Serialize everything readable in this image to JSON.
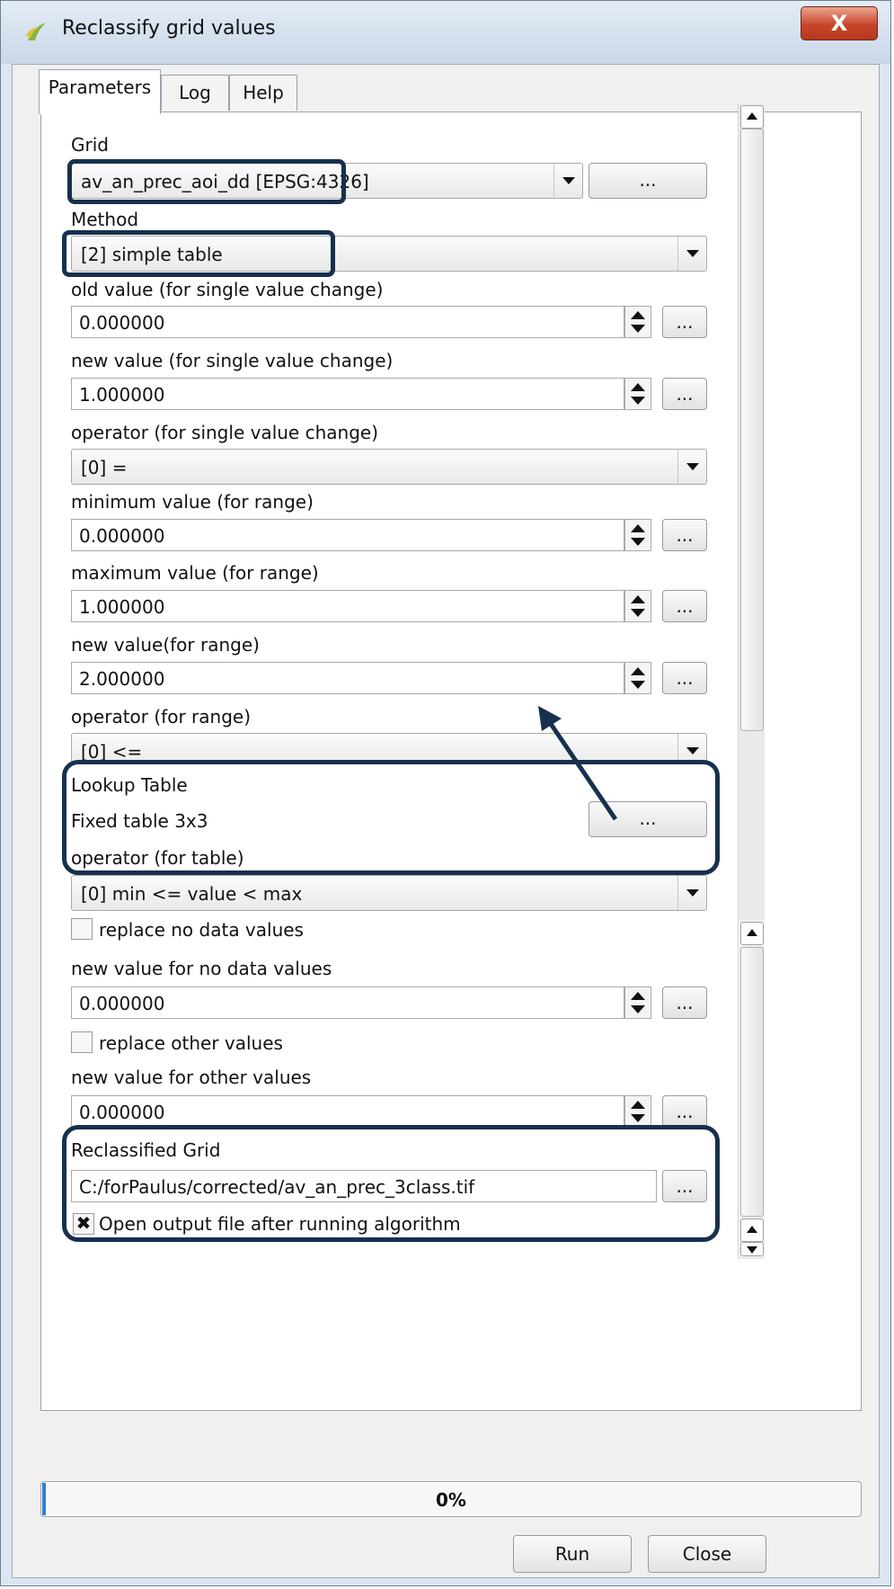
{
  "window": {
    "title": "Reclassify grid values",
    "close_glyph": "X"
  },
  "tabs": [
    {
      "label": "Parameters",
      "active": true
    },
    {
      "label": "Log",
      "active": false
    },
    {
      "label": "Help",
      "active": false
    }
  ],
  "params": {
    "grid": {
      "label": "Grid",
      "value": "av_an_prec_aoi_dd [EPSG:4326]",
      "button": "..."
    },
    "method": {
      "label": "Method",
      "value": "[2] simple table"
    },
    "old_value": {
      "label": "old value (for single value change)",
      "value": "0.000000",
      "button": "..."
    },
    "new_value": {
      "label": "new value (for single value change)",
      "value": "1.000000",
      "button": "..."
    },
    "operator_single": {
      "label": "operator (for single value change)",
      "value": "[0] ="
    },
    "min_value": {
      "label": "minimum value (for range)",
      "value": "0.000000",
      "button": "..."
    },
    "max_value": {
      "label": "maximum value (for range)",
      "value": "1.000000",
      "button": "..."
    },
    "new_value_range": {
      "label": "new value(for range)",
      "value": "2.000000",
      "button": "..."
    },
    "operator_range": {
      "label": "operator (for range)",
      "value": "[0] <="
    },
    "lookup_table": {
      "label": "Lookup Table",
      "value": "Fixed table 3x3",
      "button": "..."
    },
    "operator_table": {
      "label": "operator (for table)",
      "value": "[0] min <= value < max"
    },
    "replace_nodata": {
      "label": "replace no data values",
      "checked": false
    },
    "nodata_value": {
      "label": "new value for no data values",
      "value": "0.000000",
      "button": "..."
    },
    "replace_other": {
      "label": "replace other values",
      "checked": false
    },
    "other_value": {
      "label": "new value for other values",
      "value": "0.000000",
      "button": "..."
    },
    "output": {
      "label": "Reclassified Grid",
      "value": "C:/forPaulus/corrected/av_an_prec_3class.tif",
      "button": "..."
    },
    "open_output": {
      "label": "Open output file after running algorithm",
      "checked": true,
      "mark": "✖"
    }
  },
  "progress": {
    "text": "0%",
    "value": 0
  },
  "buttons": {
    "run": "Run",
    "close": "Close"
  },
  "colors": {
    "callout": "#17304e",
    "progress_fill": "#2f7fd4"
  }
}
